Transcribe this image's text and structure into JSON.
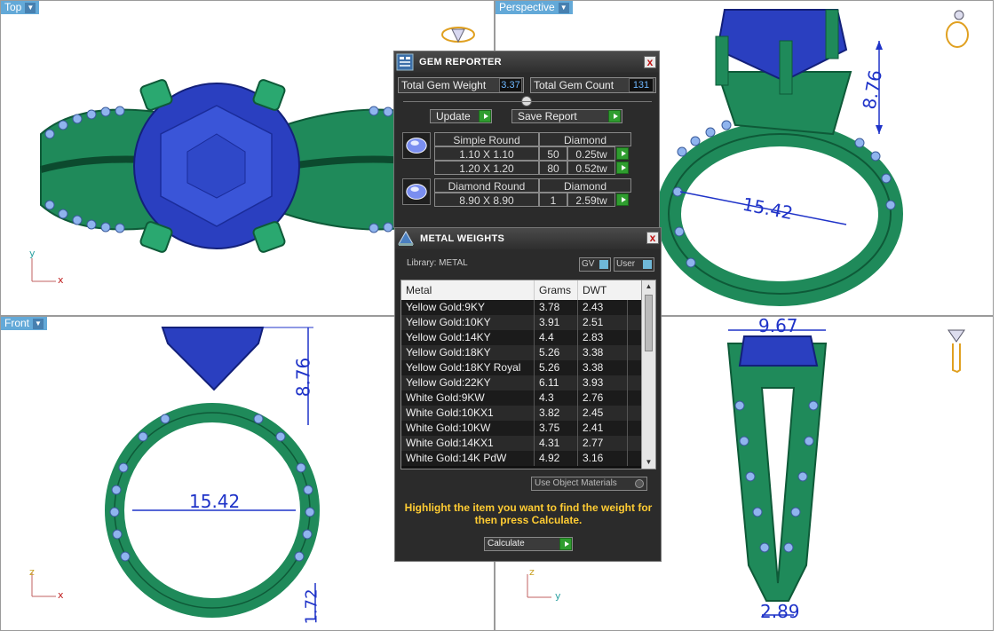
{
  "viewports": {
    "top": {
      "label": "Top",
      "axis_y": "y",
      "axis_x": "x"
    },
    "perspective": {
      "label": "Perspective"
    },
    "front": {
      "label": "Front",
      "axis_y": "z",
      "axis_x": "x"
    },
    "right": {
      "axis_y": "z",
      "axis_x": "y"
    }
  },
  "dimensions": {
    "persp_height": "8.76",
    "persp_width": "15.42",
    "front_height": "8.76",
    "front_width": "15.42",
    "front_band": "1.72",
    "right_top": "9.67",
    "right_bottom": "2.89"
  },
  "gem_reporter": {
    "title": "GEM REPORTER",
    "close": "x",
    "total_weight_label": "Total Gem Weight",
    "total_weight_value": "3.37",
    "total_count_label": "Total Gem Count",
    "total_count_value": "131",
    "update_label": "Update",
    "save_label": "Save Report",
    "groups": [
      {
        "shape": "Simple Round",
        "material": "Diamond",
        "rows": [
          {
            "size": "1.10 X 1.10",
            "count": "50",
            "weight": "0.25tw"
          },
          {
            "size": "1.20 X 1.20",
            "count": "80",
            "weight": "0.52tw"
          }
        ]
      },
      {
        "shape": "Diamond Round",
        "material": "Diamond",
        "rows": [
          {
            "size": "8.90 X 8.90",
            "count": "1",
            "weight": "2.59tw"
          }
        ]
      }
    ]
  },
  "metal_weights": {
    "title": "METAL WEIGHTS",
    "close": "x",
    "library_label": "Library: METAL",
    "gv_label": "GV",
    "user_label": "User",
    "columns": [
      "Metal",
      "Grams",
      "DWT"
    ],
    "rows": [
      [
        "Yellow Gold:9KY",
        "3.78",
        "2.43"
      ],
      [
        "Yellow Gold:10KY",
        "3.91",
        "2.51"
      ],
      [
        "Yellow Gold:14KY",
        "4.4",
        "2.83"
      ],
      [
        "Yellow Gold:18KY",
        "5.26",
        "3.38"
      ],
      [
        "Yellow Gold:18KY Royal",
        "5.26",
        "3.38"
      ],
      [
        "Yellow Gold:22KY",
        "6.11",
        "3.93"
      ],
      [
        "White Gold:9KW",
        "4.3",
        "2.76"
      ],
      [
        "White Gold:10KX1",
        "3.82",
        "2.45"
      ],
      [
        "White Gold:10KW",
        "3.75",
        "2.41"
      ],
      [
        "White Gold:14KX1",
        "4.31",
        "2.77"
      ],
      [
        "White Gold:14K PdW",
        "4.92",
        "3.16"
      ]
    ],
    "use_object_materials": "Use Object Materials",
    "hint": "Highlight the item you want to find the weight for then press Calculate.",
    "calculate_label": "Calculate"
  },
  "colors": {
    "metal": "#1f8a5a",
    "gem": "#2a3fc0",
    "pave": "#8fb4ee",
    "dimension": "#1f33c8"
  }
}
